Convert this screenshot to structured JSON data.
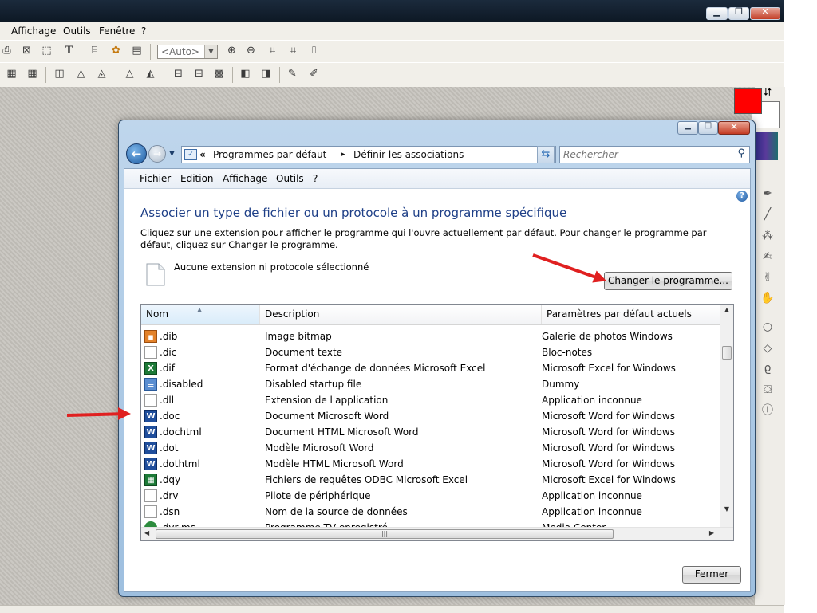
{
  "app": {
    "window_controls": {
      "minimize": "▁",
      "maximize": "❐",
      "close": "✕"
    },
    "menu": [
      "Affichage",
      "Outils",
      "Fenêtre",
      "?"
    ],
    "toolbar": {
      "zoom_value": "<Auto>"
    },
    "colors": {
      "foreground": "#ff0000",
      "background": "#ffffff"
    }
  },
  "dialog": {
    "window_controls": {
      "minimize": "▁",
      "maximize": "□",
      "close": "✕"
    },
    "address": {
      "chevron": "«",
      "crumb1": "Programmes par défaut",
      "separator": "▸",
      "crumb2": "Définir les associations"
    },
    "search": {
      "placeholder": "Rechercher"
    },
    "menu": [
      "Fichier",
      "Edition",
      "Affichage",
      "Outils",
      "?"
    ],
    "heading": "Associer un type de fichier ou un protocole à un programme spécifique",
    "instructions": "Cliquez sur une extension pour afficher le programme qui l'ouvre actuellement par défaut. Pour changer le programme par défaut, cliquez sur Changer le programme.",
    "selection_text": "Aucune extension ni protocole sélectionné",
    "change_button": "Changer le programme...",
    "columns": [
      "Nom",
      "Description",
      "Paramètres par défaut actuels"
    ],
    "rows": [
      {
        "ext": ".dib",
        "desc": "Image bitmap",
        "prog": "Galerie de photos Windows",
        "icon": "image-icon"
      },
      {
        "ext": ".dic",
        "desc": "Document texte",
        "prog": "Bloc-notes",
        "icon": "text-file-icon"
      },
      {
        "ext": ".dif",
        "desc": "Format d'échange de données Microsoft Excel",
        "prog": "Microsoft Excel for Windows",
        "icon": "excel-icon"
      },
      {
        "ext": ".disabled",
        "desc": "Disabled startup file",
        "prog": "Dummy",
        "icon": "config-file-icon"
      },
      {
        "ext": ".dll",
        "desc": "Extension de l'application",
        "prog": "Application inconnue",
        "icon": "blank-file-icon"
      },
      {
        "ext": ".doc",
        "desc": "Document Microsoft Word",
        "prog": "Microsoft Word for Windows",
        "icon": "word-icon"
      },
      {
        "ext": ".dochtml",
        "desc": "Document HTML Microsoft Word",
        "prog": "Microsoft Word for Windows",
        "icon": "word-icon"
      },
      {
        "ext": ".dot",
        "desc": "Modèle Microsoft Word",
        "prog": "Microsoft Word for Windows",
        "icon": "word-icon"
      },
      {
        "ext": ".dothtml",
        "desc": "Modèle HTML Microsoft Word",
        "prog": "Microsoft Word for Windows",
        "icon": "word-icon"
      },
      {
        "ext": ".dqy",
        "desc": "Fichiers de requêtes ODBC Microsoft Excel",
        "prog": "Microsoft Excel for Windows",
        "icon": "excel-query-icon"
      },
      {
        "ext": ".drv",
        "desc": "Pilote de périphérique",
        "prog": "Application inconnue",
        "icon": "blank-file-icon"
      },
      {
        "ext": ".dsn",
        "desc": "Nom de la source de données",
        "prog": "Application inconnue",
        "icon": "blank-file-icon"
      },
      {
        "ext": ".dvr-ms",
        "desc": "Programme TV enregistré",
        "prog": "Media Center",
        "icon": "media-icon"
      }
    ],
    "close_button": "Fermer"
  }
}
